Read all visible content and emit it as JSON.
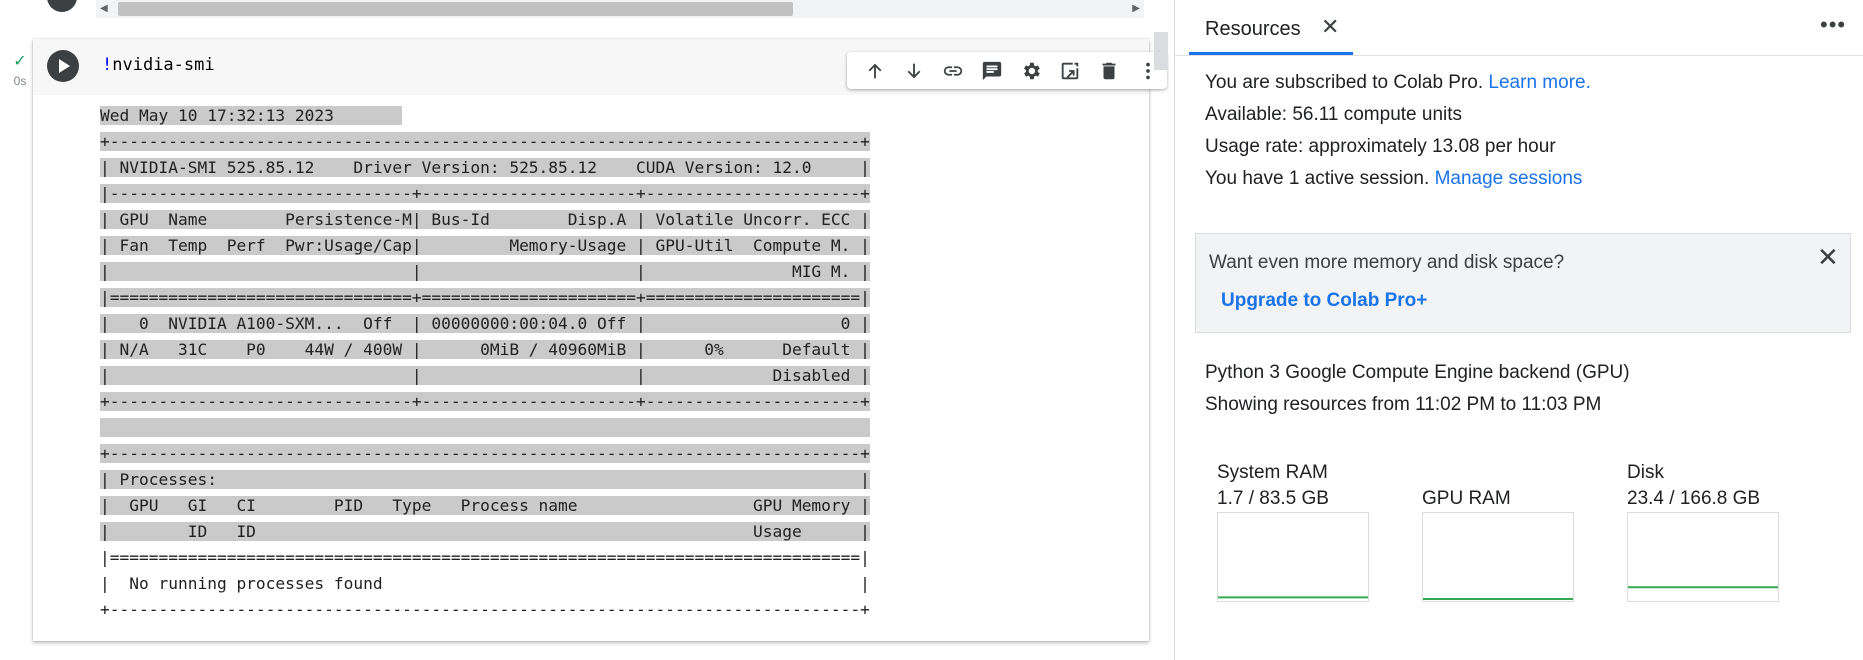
{
  "cell": {
    "status_check": "✓",
    "exec_time": "0s",
    "code_bang": "!",
    "code_rest": "nvidia-smi",
    "toolbar_icons": [
      "arrow-up-icon",
      "arrow-down-icon",
      "link-icon",
      "comment-icon",
      "gear-icon",
      "mirror-cell-icon",
      "trash-icon",
      "more-vert-icon"
    ]
  },
  "output": {
    "lines": [
      "Wed May 10 17:32:13 2023       ",
      "+-----------------------------------------------------------------------------+",
      "| NVIDIA-SMI 525.85.12    Driver Version: 525.85.12    CUDA Version: 12.0     |",
      "|-------------------------------+----------------------+----------------------+",
      "| GPU  Name        Persistence-M| Bus-Id        Disp.A | Volatile Uncorr. ECC |",
      "| Fan  Temp  Perf  Pwr:Usage/Cap|         Memory-Usage | GPU-Util  Compute M. |",
      "|                               |                      |               MIG M. |",
      "|===============================+======================+======================|",
      "|   0  NVIDIA A100-SXM...  Off  | 00000000:00:04.0 Off |                    0 |",
      "| N/A   31C    P0    44W / 400W |      0MiB / 40960MiB |      0%      Default |",
      "|                               |                      |             Disabled |",
      "+-------------------------------+----------------------+----------------------+",
      "                                                                               ",
      "+-----------------------------------------------------------------------------+",
      "| Processes:                                                                  |",
      "|  GPU   GI   CI        PID   Type   Process name                  GPU Memory |",
      "|        ID   ID                                                   Usage      |",
      "|=============================================================================|",
      "|  No running processes found                                                 |",
      "+-----------------------------------------------------------------------------+"
    ]
  },
  "resources": {
    "tab_title": "Resources",
    "tab_close": "✕",
    "more": "⋮",
    "subscription_text": "You are subscribed to Colab Pro. ",
    "learn_more": "Learn more.",
    "available": "Available: 56.11 compute units",
    "usage_rate": "Usage rate: approximately 13.08 per hour",
    "sessions_text": "You have 1 active session. ",
    "manage_sessions": "Manage sessions",
    "upgrade_prompt": "Want even more memory and disk space?",
    "upgrade_link": "Upgrade to Colab Pro+",
    "upgrade_close": "✕",
    "backend": "Python 3 Google Compute Engine backend (GPU)",
    "showing": "Showing resources from 11:02 PM to 11:03 PM",
    "meters": [
      {
        "name": "System RAM",
        "value": "1.7 / 83.5 GB",
        "fraction": 0.02
      },
      {
        "name": "GPU RAM",
        "value": "",
        "fraction": 0.0
      },
      {
        "name": "Disk",
        "value": "23.4 / 166.8 GB",
        "fraction": 0.14
      }
    ],
    "line_color": "#34a853"
  }
}
